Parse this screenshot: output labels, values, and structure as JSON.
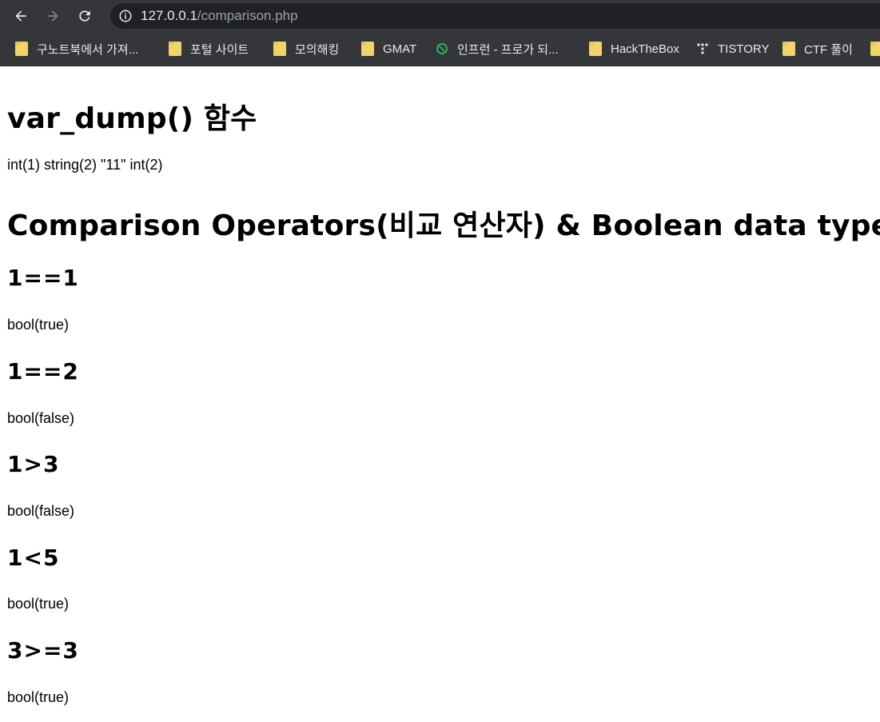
{
  "browser": {
    "url_host": "127.0.0.1",
    "url_path": "/comparison.php",
    "bookmarks": [
      {
        "label": "구노트북에서 가져...",
        "icon": "folder-icon"
      },
      {
        "label": "포털 사이트",
        "icon": "folder-icon"
      },
      {
        "label": "모의해킹",
        "icon": "folder-icon"
      },
      {
        "label": "GMAT",
        "icon": "folder-icon"
      },
      {
        "label": "인프런 - 프로가 되...",
        "icon": "inflearn-icon"
      },
      {
        "label": "HackTheBox",
        "icon": "folder-icon"
      },
      {
        "label": "TISTORY",
        "icon": "tistory-icon"
      },
      {
        "label": "CTF 풀이",
        "icon": "folder-icon"
      },
      {
        "label": "",
        "icon": "folder-icon"
      }
    ]
  },
  "page": {
    "vardump_heading": "var_dump() 함수",
    "vardump_output": "int(1) string(2) \"11\" int(2)",
    "comparison_heading": "Comparison Operators(비교 연산자) & Boolean data type",
    "cases": [
      {
        "expr": "1==1",
        "result": "bool(true)"
      },
      {
        "expr": "1==2",
        "result": "bool(false)"
      },
      {
        "expr": "1>3",
        "result": "bool(false)"
      },
      {
        "expr": "1<5",
        "result": "bool(true)"
      },
      {
        "expr": "3>=3",
        "result": "bool(true)"
      }
    ]
  }
}
